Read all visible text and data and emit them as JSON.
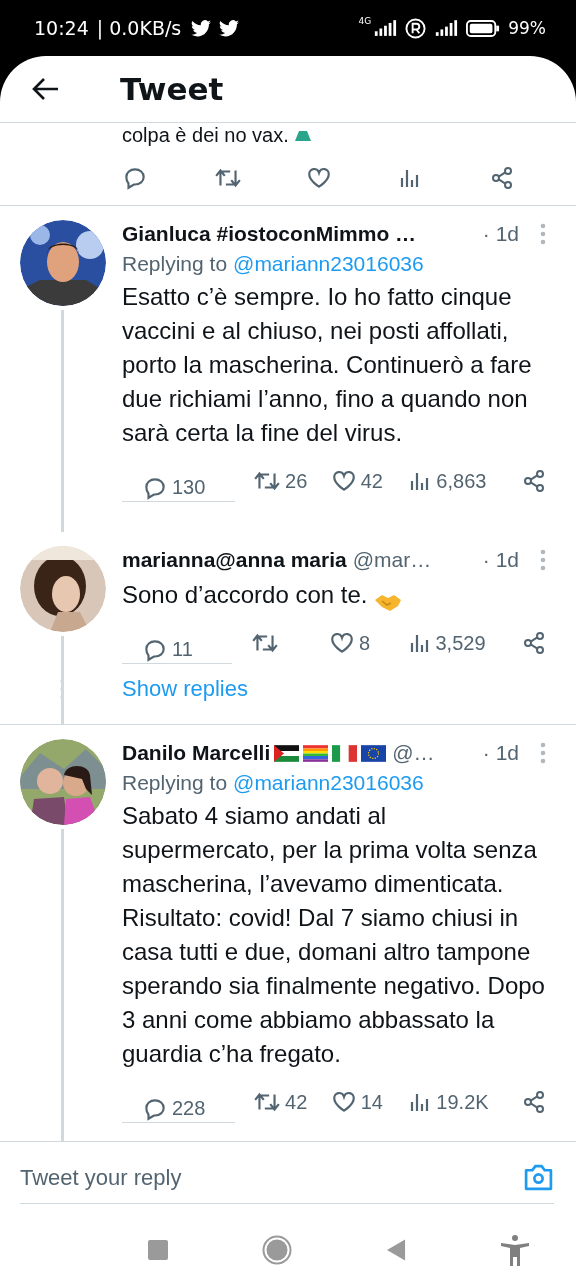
{
  "status_bar": {
    "time": "10:24",
    "speed": "| 0.0KB/s",
    "network": "4G",
    "battery": "99%"
  },
  "header": {
    "title": "Tweet"
  },
  "parent_tail": {
    "text": "colpa è dei no vax.",
    "actions": [
      {
        "kind": "reply"
      },
      {
        "kind": "retweet"
      },
      {
        "kind": "like"
      },
      {
        "kind": "views"
      },
      {
        "kind": "share"
      }
    ]
  },
  "replies": [
    {
      "name": "Gianluca #iostoconMimmo …",
      "time": "· 1d",
      "replying_to": "Replying to",
      "reply_handle": "@mariann23016036",
      "text": "Esatto c’è sempre. Io ho fatto cinque vaccini e al chiuso, nei posti affollati, porto la mascherina. Continuerò a fare due richiami l’anno, fino a quando non sarà certa la fine del virus.",
      "actions": [
        {
          "kind": "reply",
          "count": "130"
        },
        {
          "kind": "retweet",
          "count": "26"
        },
        {
          "kind": "like",
          "count": "42"
        },
        {
          "kind": "views",
          "count": "6,863"
        },
        {
          "kind": "share"
        }
      ]
    },
    {
      "name": "marianna@anna maria",
      "handle": "@mar…",
      "time": "· 1d",
      "text": "Sono d’accordo con te.",
      "emoji": {
        "kind": "handshake"
      },
      "actions": [
        {
          "kind": "reply",
          "count": "11"
        },
        {
          "kind": "retweet"
        },
        {
          "kind": "like",
          "count": "8"
        },
        {
          "kind": "views",
          "count": "3,529"
        },
        {
          "kind": "share"
        }
      ],
      "show_replies": "Show replies"
    },
    {
      "name": "Danilo Marcelli",
      "flags": [
        {
          "kind": "palestine"
        },
        {
          "kind": "rainbow"
        },
        {
          "kind": "italy"
        },
        {
          "kind": "eu"
        }
      ],
      "handle": "@…",
      "time": "· 1d",
      "replying_to": "Replying to",
      "reply_handle": "@mariann23016036",
      "text": "Sabato 4 siamo andati al supermercato, per la prima volta senza mascherina, l’avevamo dimenticata. Risultato: covid! Dal 7 siamo chiusi in casa tutti e due, domani altro tampone sperando sia finalmente negativo. Dopo 3 anni come abbiamo abbassato la guardia c’ha fregato.",
      "actions": [
        {
          "kind": "reply",
          "count": "228"
        },
        {
          "kind": "retweet",
          "count": "42"
        },
        {
          "kind": "like",
          "count": "14"
        },
        {
          "kind": "views",
          "count": "19.2K"
        },
        {
          "kind": "share"
        }
      ]
    }
  ],
  "reply_field": {
    "placeholder": "Tweet your reply"
  }
}
